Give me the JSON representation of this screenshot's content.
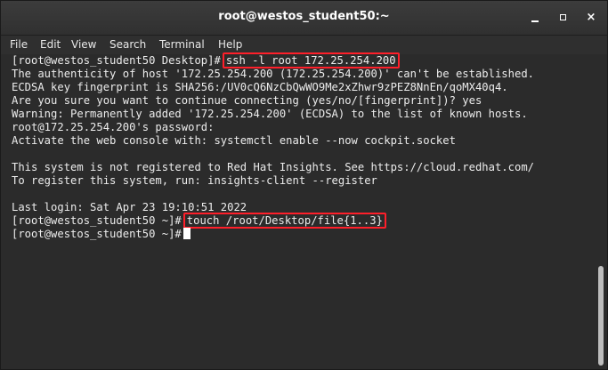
{
  "window": {
    "title": "root@westos_student50:~",
    "minimize_label": "_",
    "maximize_label": "□",
    "close_label": "×"
  },
  "menubar": {
    "items": [
      "File",
      "Edit",
      "View",
      "Search",
      "Terminal",
      "Help"
    ]
  },
  "terminal": {
    "lines": [
      {
        "prompt": "[root@westos_student50 Desktop]#",
        "command": "ssh -l root 172.25.254.200",
        "highlighted": true
      },
      {
        "text": "The authenticity of host '172.25.254.200 (172.25.254.200)' can't be established."
      },
      {
        "text": "ECDSA key fingerprint is SHA256:/UV0cQ6NzCbQwWO9Me2xZhwr9zPEZ8NnEn/qoMX40q4."
      },
      {
        "text": "Are you sure you want to continue connecting (yes/no/[fingerprint])? yes"
      },
      {
        "text": "Warning: Permanently added '172.25.254.200' (ECDSA) to the list of known hosts."
      },
      {
        "text": "root@172.25.254.200's password:"
      },
      {
        "text": "Activate the web console with: systemctl enable --now cockpit.socket"
      },
      {
        "text": ""
      },
      {
        "text": "This system is not registered to Red Hat Insights. See https://cloud.redhat.com/"
      },
      {
        "text": "To register this system, run: insights-client --register"
      },
      {
        "text": ""
      },
      {
        "text": "Last login: Sat Apr 23 19:10:51 2022"
      },
      {
        "prompt": "[root@westos_student50 ~]#",
        "command": "touch /root/Desktop/file{1..3}",
        "highlighted": true
      },
      {
        "prompt": "[root@westos_student50 ~]#",
        "command": "",
        "cursor": true
      }
    ]
  },
  "colors": {
    "background": "#2b2b2b",
    "text": "#ececec",
    "highlight_border": "#ff1f2a",
    "titlebar": "#333333"
  }
}
